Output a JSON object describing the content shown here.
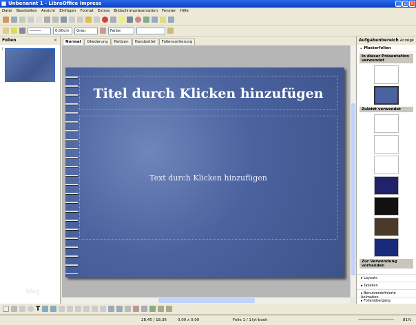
{
  "window": {
    "title": "Unbenannt 1 - LibreOffice Impress"
  },
  "menu": [
    "Datei",
    "Bearbeiten",
    "Ansicht",
    "Einfügen",
    "Format",
    "Extras",
    "Bildschirmpräsentation",
    "Fenster",
    "Hilfe"
  ],
  "toolbar": {
    "line_width": "0,00cm",
    "line_color": "Grau",
    "fill_type": "Farbe"
  },
  "slides_pane": {
    "title": "Folien",
    "slide_number": "1"
  },
  "view_tabs": [
    "Normal",
    "Gliederung",
    "Notizen",
    "Handzettel",
    "Foliensortierung"
  ],
  "slide": {
    "title_placeholder": "Titel durch Klicken hinzufügen",
    "body_placeholder": "Text durch Klicken hinzufügen"
  },
  "task_pane": {
    "title": "Aufgabenbereich",
    "view_menu": "Anzeige",
    "master_header": "Masterfolien",
    "sections": [
      "In dieser Präsentation verwendet",
      "Zuletzt verwendet",
      "Zur Verwendung vorhanden"
    ],
    "collapsed": [
      "Layouts",
      "Tabellen",
      "Benutzerdefinierte Animation",
      "Folienübergang"
    ]
  },
  "status": {
    "position": "28,45 / 18,36",
    "size": "0,00 x 0,00",
    "slide": "Folie 1 / 1",
    "master": "lyt-book",
    "zoom": "81%"
  },
  "watermark": "blog",
  "colors": {
    "accent": "#316ac5",
    "titlebar": "#0a3fc4"
  }
}
